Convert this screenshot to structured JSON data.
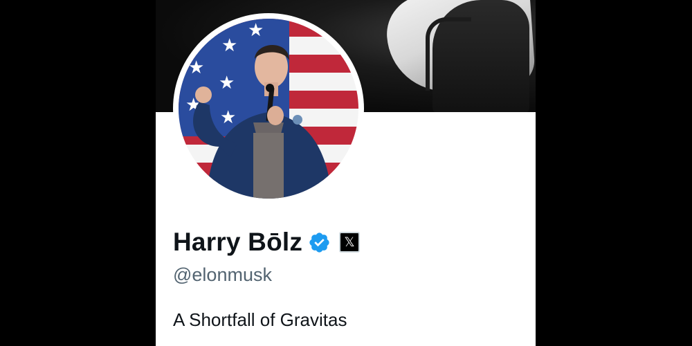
{
  "profile": {
    "display_name": "Harry Bōlz",
    "handle": "@elonmusk",
    "bio": "A Shortfall of Gravitas",
    "verified": true,
    "affiliate_badge_glyph": "𝕏"
  },
  "icons": {
    "verified": "verified-badge-icon",
    "affiliate": "x-logo-icon"
  },
  "colors": {
    "verified_blue": "#1d9bf0",
    "name_text": "#0f1419",
    "handle_text": "#536471",
    "page_background": "#000000",
    "card_background": "#ffffff"
  }
}
